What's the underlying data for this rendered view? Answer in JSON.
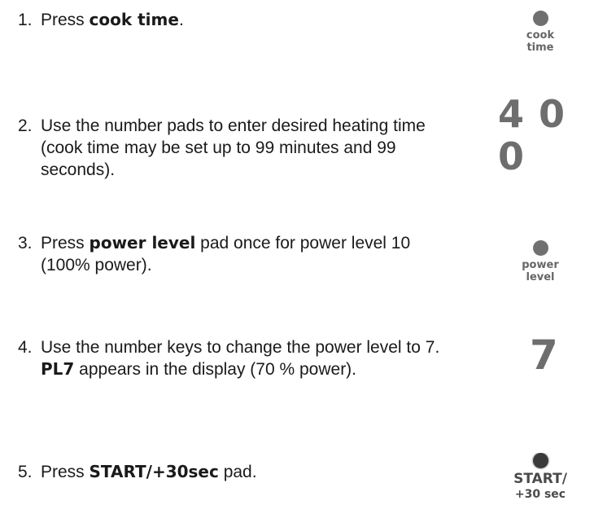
{
  "steps": [
    {
      "number": "1.",
      "before": "Press ",
      "bold": "cook time",
      "after": "."
    },
    {
      "number": "2.",
      "text": "Use the number pads to enter desired heating time (cook time may be set up to 99 minutes and 99 seconds)."
    },
    {
      "number": "3.",
      "before": "Press ",
      "bold": "power level",
      "after": " pad once for power level 10 (100% power)."
    },
    {
      "number": "4.",
      "before": "Use the number keys to change the power level to 7. ",
      "bold": "PL7",
      "after": " appears in the display (70 % power)."
    },
    {
      "number": "5.",
      "before": "Press ",
      "bold": "START/+30sec",
      "after": " pad."
    }
  ],
  "pads": {
    "cook_time": {
      "line1": "cook",
      "line2": "time"
    },
    "power_level": {
      "line1": "power",
      "line2": "level"
    },
    "start": {
      "line1": "START/",
      "line2": "+30 sec"
    }
  },
  "displays": {
    "time": "4 0 0",
    "power": "7"
  },
  "colors": {
    "pad_dot": "#707070",
    "start_dot": "#3a3a3a",
    "label": "#666666",
    "digits": "#6e6e6e"
  }
}
